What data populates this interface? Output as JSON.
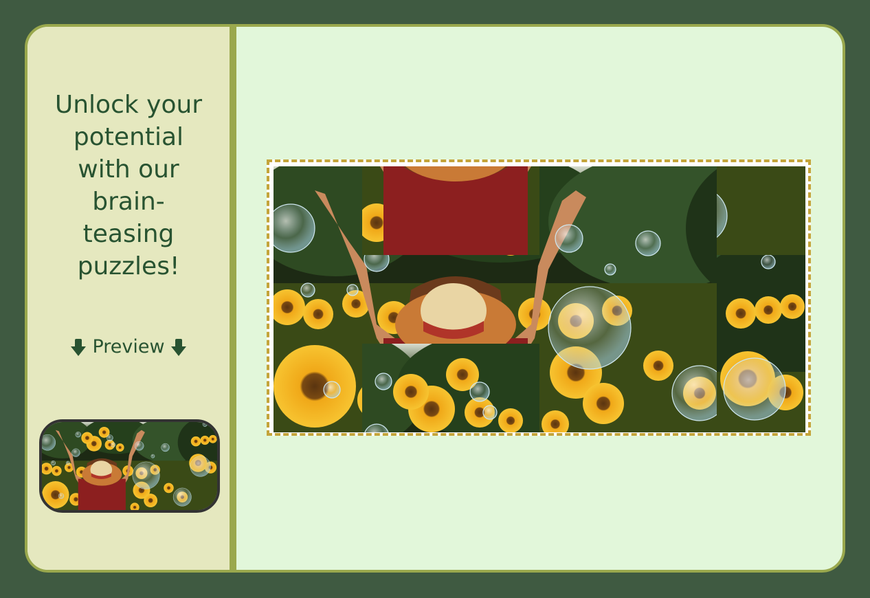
{
  "sidebar": {
    "headline": "Unlock your\npotential\nwith our\nbrain-\nteasing\npuzzles!",
    "preview_label": "Preview",
    "arrow_icon": "down-arrow-icon"
  },
  "puzzle": {
    "columns": 6,
    "rows": 3,
    "tile_order": [
      0,
      13,
      14,
      3,
      4,
      17,
      6,
      7,
      8,
      9,
      10,
      5,
      12,
      1,
      2,
      15,
      16,
      11
    ]
  },
  "colors": {
    "background": "#3f5a41",
    "border": "#9aa84d",
    "sidebar": "#e5e8bf",
    "panel": "#e2f7da",
    "text": "#285331",
    "board_border": "#c4a43a"
  }
}
